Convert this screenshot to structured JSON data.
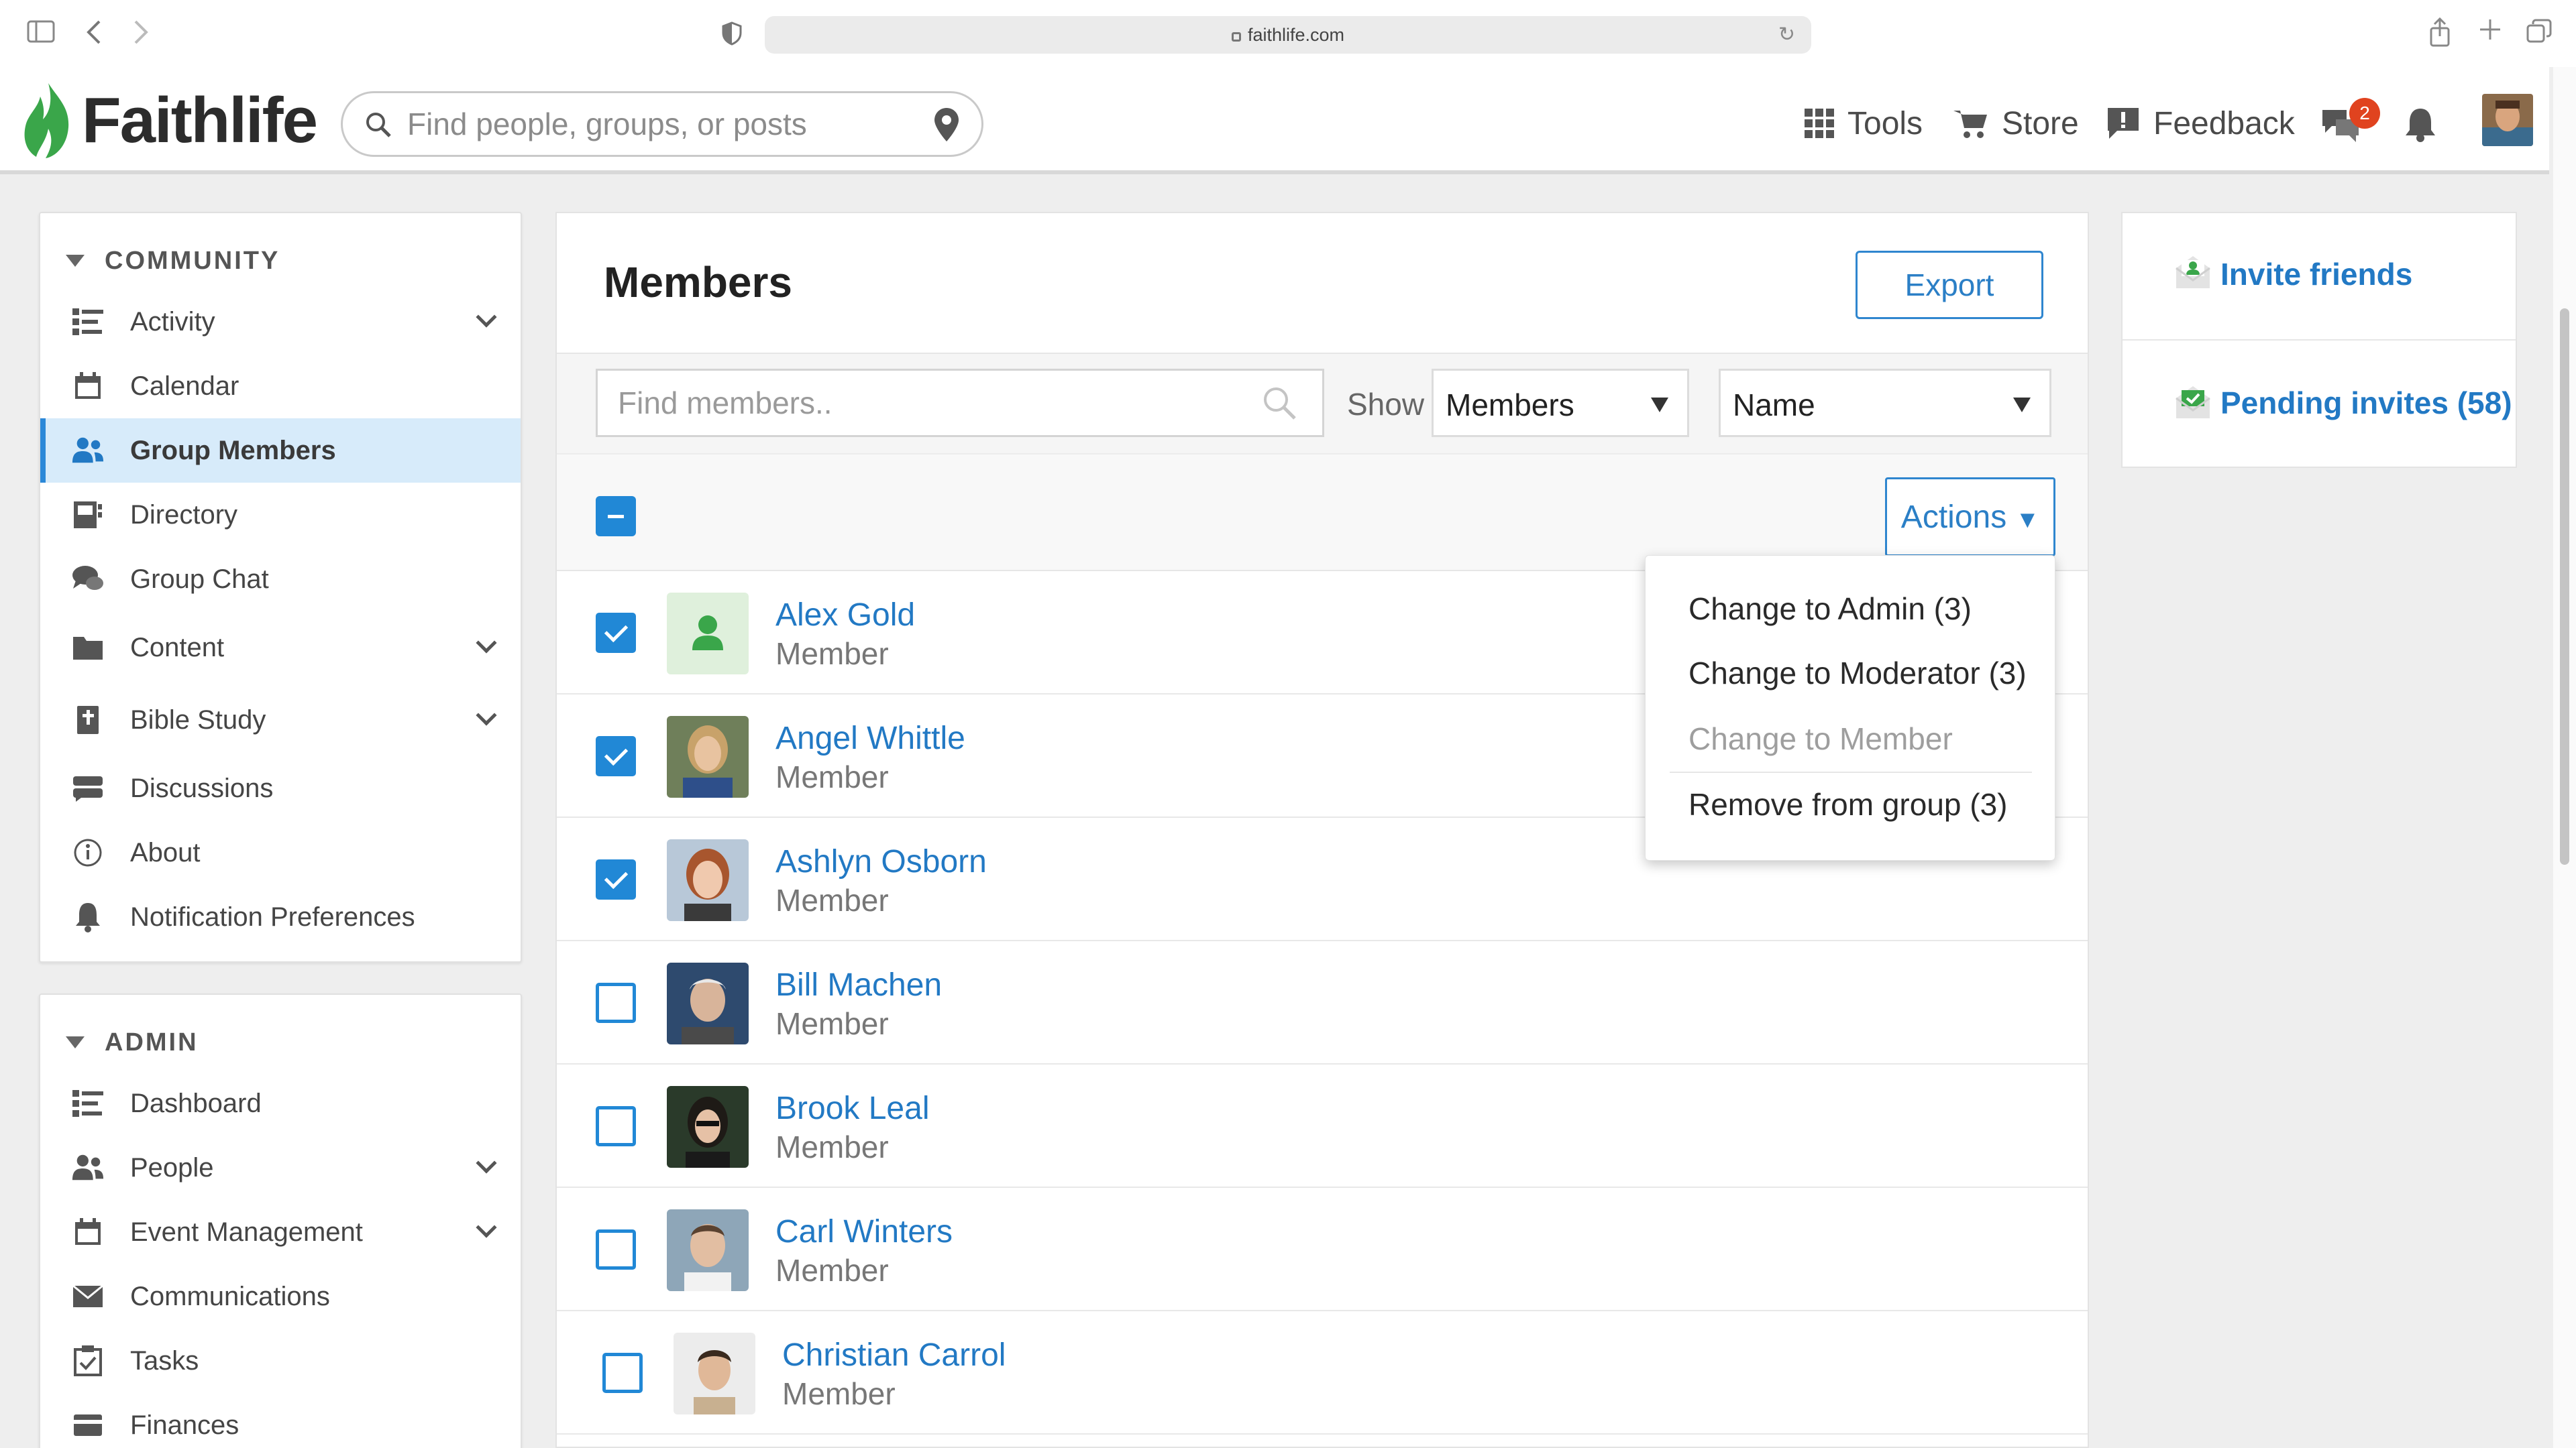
{
  "browser": {
    "url": "faithlife.com"
  },
  "header": {
    "logo_text": "Faithlife",
    "search_placeholder": "Find people, groups, or posts",
    "nav": {
      "tools": "Tools",
      "store": "Store",
      "feedback": "Feedback"
    },
    "messages_badge": "2"
  },
  "sidebar": {
    "community_title": "COMMUNITY",
    "community_items": [
      {
        "label": "Activity",
        "icon": "activity-icon",
        "expandable": true
      },
      {
        "label": "Calendar",
        "icon": "calendar-icon"
      },
      {
        "label": "Group Members",
        "icon": "people-icon",
        "active": true
      },
      {
        "label": "Directory",
        "icon": "directory-icon"
      },
      {
        "label": "Group Chat",
        "icon": "chat-icon"
      },
      {
        "label": "Content",
        "icon": "folder-icon",
        "expandable": true
      },
      {
        "label": "Bible Study",
        "icon": "bible-icon",
        "expandable": true
      },
      {
        "label": "Discussions",
        "icon": "discussions-icon"
      },
      {
        "label": "About",
        "icon": "info-icon"
      },
      {
        "label": "Notification Preferences",
        "icon": "bell-icon"
      }
    ],
    "admin_title": "ADMIN",
    "admin_items": [
      {
        "label": "Dashboard",
        "icon": "dashboard-icon"
      },
      {
        "label": "People",
        "icon": "people-icon",
        "expandable": true
      },
      {
        "label": "Event Management",
        "icon": "calendar-icon",
        "expandable": true
      },
      {
        "label": "Communications",
        "icon": "envelope-icon"
      },
      {
        "label": "Tasks",
        "icon": "tasks-icon"
      },
      {
        "label": "Finances",
        "icon": "card-icon"
      }
    ]
  },
  "main": {
    "title": "Members",
    "export_label": "Export",
    "find_placeholder": "Find members..",
    "show_label": "Show",
    "show_value": "Members",
    "sort_value": "Name",
    "actions_label": "Actions",
    "members": [
      {
        "name": "Alex Gold",
        "role": "Member",
        "checked": true
      },
      {
        "name": "Angel Whittle",
        "role": "Member",
        "checked": true
      },
      {
        "name": "Ashlyn Osborn",
        "role": "Member",
        "checked": true
      },
      {
        "name": "Bill Machen",
        "role": "Member",
        "checked": false
      },
      {
        "name": "Brook Leal",
        "role": "Member",
        "checked": false
      },
      {
        "name": "Carl Winters",
        "role": "Member",
        "checked": false
      },
      {
        "name": "Christian Carrol",
        "role": "Member",
        "checked": false
      }
    ]
  },
  "actions_menu": {
    "items": [
      {
        "label": "Change to Admin (3)",
        "enabled": true
      },
      {
        "label": "Change to Moderator (3)",
        "enabled": true
      },
      {
        "label": "Change to Member",
        "enabled": false
      },
      {
        "label": "Remove from group (3)",
        "enabled": true
      }
    ]
  },
  "right_panel": {
    "invite_friends": "Invite friends",
    "pending_invites": "Pending invites (58)"
  },
  "colors": {
    "accent": "#2279c4",
    "brand_green": "#3aa64a",
    "active_bg": "#d7ebfa",
    "badge": "#e0431f"
  }
}
